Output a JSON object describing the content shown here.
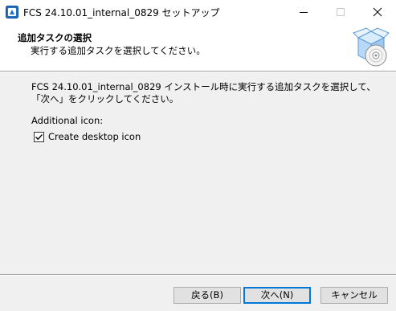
{
  "window": {
    "title": "FCS 24.10.01_internal_0829 セットアップ"
  },
  "header": {
    "title": "追加タスクの選択",
    "subtitle": "実行する追加タスクを選択してください。"
  },
  "body": {
    "description": "FCS 24.10.01_internal_0829 インストール時に実行する追加タスクを選択して、「次へ」をクリックしてください。",
    "group_label": "Additional icon:",
    "checkbox": {
      "label": "Create desktop icon",
      "checked": true
    }
  },
  "buttons": {
    "back": "戻る(B)",
    "next": "次へ(N)",
    "cancel": "キャンセル"
  },
  "icons": {
    "app": "setup-app-icon",
    "header": "install-box-cd-icon",
    "minimize": "minimize-icon",
    "maximize": "maximize-icon",
    "close": "close-icon",
    "check": "checkmark-icon"
  },
  "colors": {
    "accent": "#0078d7",
    "window_bg": "#f0f0f0",
    "header_bg": "#ffffff",
    "button_bg": "#e1e1e1"
  }
}
